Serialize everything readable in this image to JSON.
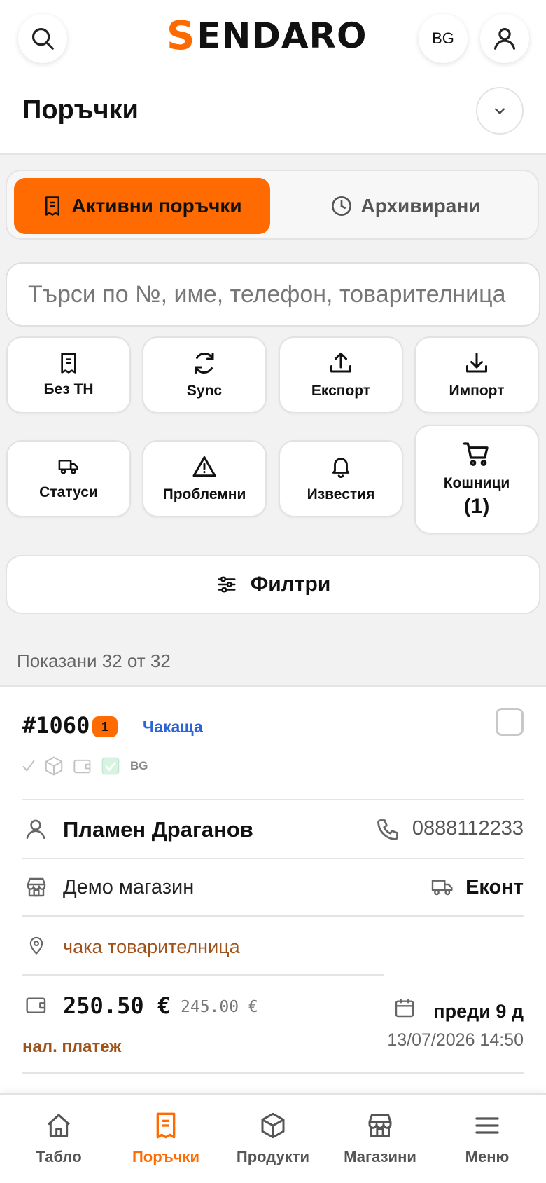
{
  "header": {
    "logo_letter": "S",
    "logo_rest": "ENDARO",
    "language": "BG",
    "search_icon": "search-icon",
    "profile_icon": "user-icon"
  },
  "page": {
    "title": "Поръчки"
  },
  "tabs": [
    {
      "label": "Активни поръчки",
      "icon": "receipt-icon",
      "active": true
    },
    {
      "label": "Архивирани",
      "icon": "clock-icon",
      "active": false
    }
  ],
  "search": {
    "placeholder": "Търси по №, име, телефон, товарителница"
  },
  "actions": [
    {
      "label": "Без ТН",
      "icon": "receipt-icon"
    },
    {
      "label": "Sync",
      "icon": "refresh-icon"
    },
    {
      "label": "Експорт",
      "icon": "upload-icon"
    },
    {
      "label": "Импорт",
      "icon": "download-icon"
    },
    {
      "label": "Статуси",
      "icon": "truck-icon"
    },
    {
      "label": "Проблемни",
      "icon": "warning-icon"
    },
    {
      "label": "Известия",
      "icon": "bell-icon"
    },
    {
      "label": "Кошници",
      "icon": "cart-icon",
      "count": "(1)"
    }
  ],
  "filters": {
    "label": "Филтри"
  },
  "list_info": {
    "shown": "Показани 32 от 32"
  },
  "orders": [
    {
      "number": "#1060",
      "count": "1",
      "status": "Чакаща",
      "flags_label": "BG",
      "customer": "Пламен Драганов",
      "phone": "0888112233",
      "shop": "Демо магазин",
      "courier": "Еконт",
      "address_status": "чака товарителница",
      "price": "250.50 €",
      "price_old": "245.00 €",
      "payment": "нал. платеж",
      "relative_time": "преди 9 д",
      "datetime": "13/07/2026 14:50"
    }
  ],
  "bottom_nav": [
    {
      "label": "Табло",
      "icon": "home-icon",
      "active": false
    },
    {
      "label": "Поръчки",
      "icon": "receipt-icon",
      "active": true
    },
    {
      "label": "Продукти",
      "icon": "box-icon",
      "active": false
    },
    {
      "label": "Магазини",
      "icon": "store-icon",
      "active": false
    },
    {
      "label": "Меню",
      "icon": "menu-icon",
      "active": false
    }
  ],
  "colors": {
    "accent": "#ff6b00",
    "status_blue": "#2c63d6",
    "brown": "#a0521b"
  }
}
